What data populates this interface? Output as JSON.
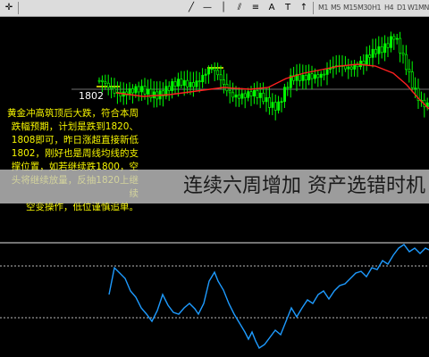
{
  "toolbar": {
    "icons": [
      "crosshair-icon",
      "line-icon",
      "hline-icon",
      "vline-icon",
      "channel-icon",
      "fibo-icon",
      "text-icon",
      "label-icon",
      "arrow-icon"
    ],
    "timeframes": [
      "M1",
      "M5",
      "M15",
      "M30",
      "H1",
      "H4",
      "D1",
      "W1",
      "MN"
    ]
  },
  "chart": {
    "price_level_label": "1802",
    "price_tag_label": "1802",
    "annotation": "黄金冲高筑顶后大跌，符合本周\n跌幅预期，计划是跌到1820、\n1808即可，昨日涨超直接新低\n1802，刚好也是周线均线的支\n撑位置，如若继续跌1800，空\n头将继续放量，反抽1820上继续\n空变操作，低位谨慎追单。",
    "banner": "连续六周增加 资产选错时机"
  },
  "colors": {
    "background": "#000000",
    "bull_candle": "#00ff00",
    "bear_candle": "#00ff00",
    "ma_line": "#ff2020",
    "oscillator": "#00a0ff",
    "level_line": "#ffffff",
    "annotation": "#ffff00"
  }
}
